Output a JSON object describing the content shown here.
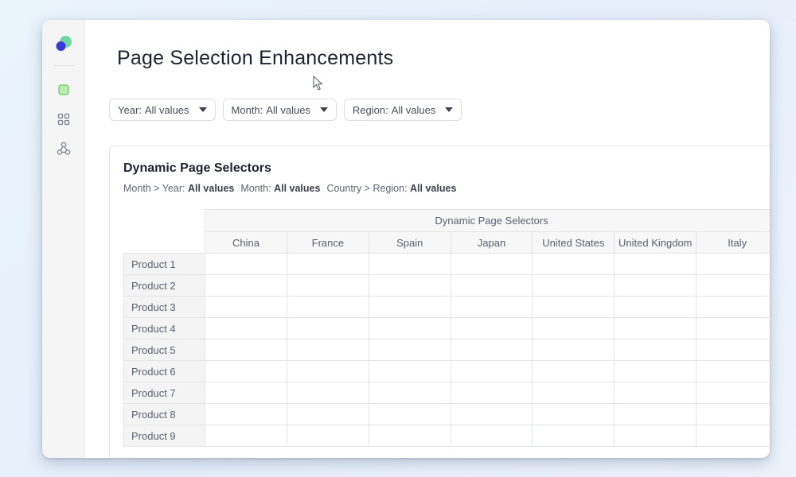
{
  "page": {
    "title": "Page Selection Enhancements"
  },
  "filters": [
    {
      "label": "Year:",
      "value": "All values"
    },
    {
      "label": "Month:",
      "value": "All values"
    },
    {
      "label": "Region:",
      "value": "All values"
    }
  ],
  "card": {
    "title": "Dynamic Page Selectors",
    "crumbs": [
      {
        "label": "Month > Year:",
        "value": "All values"
      },
      {
        "label": "Month:",
        "value": "All values"
      },
      {
        "label": "Country > Region:",
        "value": "All values"
      }
    ]
  },
  "grid": {
    "group_header": "Dynamic Page Selectors",
    "columns": [
      "China",
      "France",
      "Spain",
      "Japan",
      "United States",
      "United Kingdom",
      "Italy"
    ],
    "rows": [
      "Product 1",
      "Product 2",
      "Product 3",
      "Product 4",
      "Product 5",
      "Product 6",
      "Product 7",
      "Product 8",
      "Product 9"
    ]
  },
  "colors": {
    "logo_green": "#6fd7a0",
    "logo_blue": "#3b3ad6",
    "accent_green": "#8fdc8f"
  },
  "icons": {
    "sidebar": [
      "square-icon",
      "grid-icon",
      "network-icon"
    ],
    "filter_caret": "caret-down-icon"
  }
}
